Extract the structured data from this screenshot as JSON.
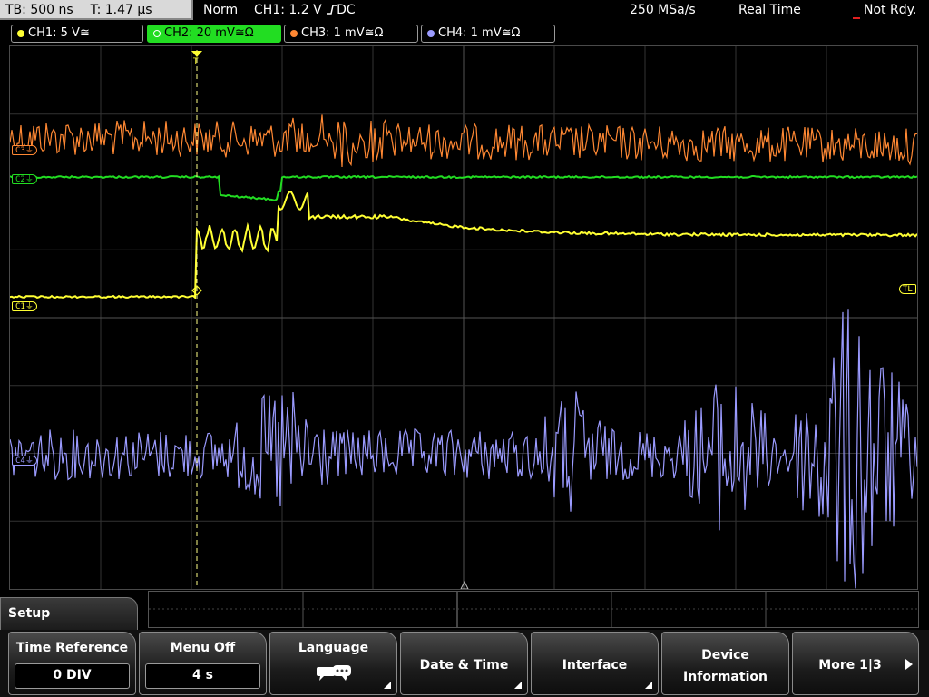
{
  "status_bar": {
    "timebase": "TB: 500 ns",
    "trigger_time": "T: 1.47 µs",
    "mode": "Norm",
    "trigger_info": "CH1: 1.2 V",
    "trigger_coupling": "DC",
    "sample_rate": "250 MSa/s",
    "acq_mode": "Real Time",
    "state": "Not Rdy."
  },
  "channels": [
    {
      "label": "CH1: 5 V",
      "coupling": "≅",
      "color": "#ffff33",
      "active": false
    },
    {
      "label": "CH2: 20 mV",
      "coupling": "≅Ω",
      "color": "#22dd22",
      "active": true
    },
    {
      "label": "CH3: 1 mV",
      "coupling": "≅Ω",
      "color": "#ff8833",
      "active": false
    },
    {
      "label": "CH4: 1 mV",
      "coupling": "≅Ω",
      "color": "#9b9bff",
      "active": false
    }
  ],
  "markers": {
    "c3": "C3",
    "c2": "C2",
    "c1": "C1",
    "c4": "C4",
    "trigger_level": "TL",
    "trigger_pos": "T"
  },
  "menu": {
    "title": "Setup",
    "time_reference": {
      "label": "Time Reference",
      "value": "0 DIV"
    },
    "menu_off": {
      "label": "Menu Off",
      "value": "4 s"
    },
    "language": {
      "label": "Language",
      "icon": "speech-bubble-icon"
    },
    "date_time": {
      "label": "Date & Time"
    },
    "interface": {
      "label": "Interface"
    },
    "device_info": {
      "label_line1": "Device",
      "label_line2": "Information"
    },
    "more": {
      "label": "More 1|3"
    }
  },
  "colors": {
    "ch1": "#ffff33",
    "ch2": "#22dd22",
    "ch3": "#ff8833",
    "ch4": "#9b9bff",
    "grid": "#3c3c3c",
    "trigger": "#ffff33"
  }
}
